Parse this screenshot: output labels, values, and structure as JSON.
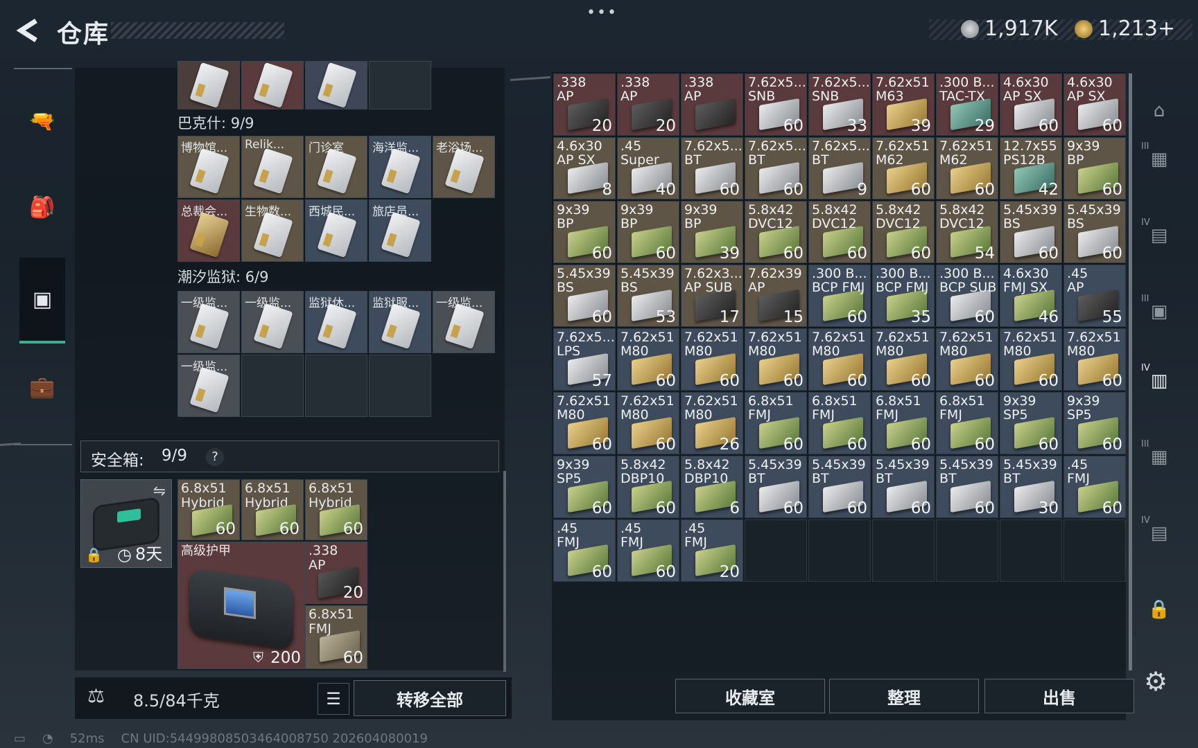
{
  "header": {
    "title": "仓库",
    "currencies": [
      {
        "icon": "silver-coin-icon",
        "value": "1,917K",
        "color": "#b8bcc0"
      },
      {
        "icon": "gold-coin-icon",
        "value": "1,213+",
        "color": "#c9a24a"
      }
    ]
  },
  "left_nav": [
    {
      "icon": "pistol-icon"
    },
    {
      "icon": "backpack-icon"
    },
    {
      "icon": "storage-case-icon",
      "active": true
    },
    {
      "icon": "briefcase-icon"
    }
  ],
  "left": {
    "group1_title": "巴克什: 9/9",
    "group1": [
      {
        "n": "博物馆...",
        "c": "tan"
      },
      {
        "n": "Relik...",
        "c": "tan"
      },
      {
        "n": "门诊室",
        "c": "tan"
      },
      {
        "n": "海洋监...",
        "c": "blue"
      },
      {
        "n": "老浴场...",
        "c": "tan"
      },
      {
        "n": "总裁会...",
        "c": "red",
        "gold": true
      },
      {
        "n": "生物数...",
        "c": "tan"
      },
      {
        "n": "西城民...",
        "c": "blue"
      },
      {
        "n": "旅店员...",
        "c": "blue"
      }
    ],
    "group2_title": "潮汐监狱: 6/9",
    "group2": [
      {
        "n": "一级监...",
        "c": "grey"
      },
      {
        "n": "一级监...",
        "c": "grey"
      },
      {
        "n": "监狱休...",
        "c": "blue"
      },
      {
        "n": "监狱服...",
        "c": "blue"
      },
      {
        "n": "一级监...",
        "c": "grey"
      },
      {
        "n": "一级监...",
        "c": "grey"
      }
    ],
    "safebox_label": "安全箱:",
    "safebox_count": "9/9",
    "safebox_help": "?",
    "safebox_timer": "8天",
    "safebox_items": [
      {
        "n": "6.8x51\nHybrid",
        "q": "60"
      },
      {
        "n": "6.8x51\nHybrid",
        "q": "60"
      },
      {
        "n": "6.8x51\nHybrid",
        "q": "60"
      }
    ],
    "armor_label": "高级护甲",
    "armor_value": "200",
    "ap338": {
      "n": ".338\nAP",
      "q": "20"
    },
    "fmj68": {
      "n": "6.8x51\nFMJ",
      "q": "60"
    },
    "weight": "8.5/84千克",
    "transfer_all": "转移全部"
  },
  "grid": [
    {
      "n": ".338\nAP",
      "q": "20",
      "c": "red"
    },
    {
      "n": ".338\nAP",
      "q": "20",
      "c": "red"
    },
    {
      "n": ".338\nAP",
      "q": "",
      "c": "red"
    },
    {
      "n": "7.62x5...\nSNB",
      "q": "60",
      "c": "red"
    },
    {
      "n": "7.62x5...\nSNB",
      "q": "33",
      "c": "red"
    },
    {
      "n": "7.62x51\nM63",
      "q": "39",
      "c": "red"
    },
    {
      "n": ".300 B...\nTAC-TX",
      "q": "29",
      "c": "red"
    },
    {
      "n": "4.6x30\nAP SX",
      "q": "60",
      "c": "red"
    },
    {
      "n": "4.6x30\nAP SX",
      "q": "60",
      "c": "red"
    },
    {
      "n": "4.6x30\nAP SX",
      "q": "8",
      "c": "tan"
    },
    {
      "n": ".45\nSuper",
      "q": "40",
      "c": "tan"
    },
    {
      "n": "7.62x5...\nBT",
      "q": "60",
      "c": "tan"
    },
    {
      "n": "7.62x5...\nBT",
      "q": "60",
      "c": "tan"
    },
    {
      "n": "7.62x5...\nBT",
      "q": "9",
      "c": "tan"
    },
    {
      "n": "7.62x51\nM62",
      "q": "60",
      "c": "tan"
    },
    {
      "n": "7.62x51\nM62",
      "q": "60",
      "c": "tan"
    },
    {
      "n": "12.7x55\nPS12B",
      "q": "42",
      "c": "tan"
    },
    {
      "n": "9x39\nBP",
      "q": "60",
      "c": "tan"
    },
    {
      "n": "9x39\nBP",
      "q": "60",
      "c": "tan"
    },
    {
      "n": "9x39\nBP",
      "q": "60",
      "c": "tan"
    },
    {
      "n": "9x39\nBP",
      "q": "39",
      "c": "tan"
    },
    {
      "n": "5.8x42\nDVC12",
      "q": "60",
      "c": "tan"
    },
    {
      "n": "5.8x42\nDVC12",
      "q": "60",
      "c": "tan"
    },
    {
      "n": "5.8x42\nDVC12",
      "q": "60",
      "c": "tan"
    },
    {
      "n": "5.8x42\nDVC12",
      "q": "54",
      "c": "tan"
    },
    {
      "n": "5.45x39\nBS",
      "q": "60",
      "c": "tan"
    },
    {
      "n": "5.45x39\nBS",
      "q": "60",
      "c": "tan"
    },
    {
      "n": "5.45x39\nBS",
      "q": "60",
      "c": "tan"
    },
    {
      "n": "5.45x39\nBS",
      "q": "53",
      "c": "tan"
    },
    {
      "n": "7.62x3...\nAP SUB",
      "q": "17",
      "c": "tan"
    },
    {
      "n": "7.62x39\nAP",
      "q": "15",
      "c": "tan"
    },
    {
      "n": ".300 B...\nBCP FMJ",
      "q": "60",
      "c": "blue"
    },
    {
      "n": ".300 B...\nBCP FMJ",
      "q": "35",
      "c": "blue"
    },
    {
      "n": ".300 B...\nBCP SUB",
      "q": "60",
      "c": "blue"
    },
    {
      "n": "4.6x30\nFMJ SX",
      "q": "46",
      "c": "blue"
    },
    {
      "n": ".45\nAP",
      "q": "55",
      "c": "blue"
    },
    {
      "n": "7.62x5...\nLPS",
      "q": "57",
      "c": "blue"
    },
    {
      "n": "7.62x51\nM80",
      "q": "60",
      "c": "blue"
    },
    {
      "n": "7.62x51\nM80",
      "q": "60",
      "c": "blue"
    },
    {
      "n": "7.62x51\nM80",
      "q": "60",
      "c": "blue"
    },
    {
      "n": "7.62x51\nM80",
      "q": "60",
      "c": "blue"
    },
    {
      "n": "7.62x51\nM80",
      "q": "60",
      "c": "blue"
    },
    {
      "n": "7.62x51\nM80",
      "q": "60",
      "c": "blue"
    },
    {
      "n": "7.62x51\nM80",
      "q": "60",
      "c": "blue"
    },
    {
      "n": "7.62x51\nM80",
      "q": "60",
      "c": "blue"
    },
    {
      "n": "7.62x51\nM80",
      "q": "60",
      "c": "blue"
    },
    {
      "n": "7.62x51\nM80",
      "q": "60",
      "c": "blue"
    },
    {
      "n": "7.62x51\nM80",
      "q": "26",
      "c": "blue"
    },
    {
      "n": "6.8x51\nFMJ",
      "q": "60",
      "c": "blue"
    },
    {
      "n": "6.8x51\nFMJ",
      "q": "60",
      "c": "blue"
    },
    {
      "n": "6.8x51\nFMJ",
      "q": "60",
      "c": "blue"
    },
    {
      "n": "6.8x51\nFMJ",
      "q": "60",
      "c": "blue"
    },
    {
      "n": "9x39\nSP5",
      "q": "60",
      "c": "blue"
    },
    {
      "n": "9x39\nSP5",
      "q": "60",
      "c": "blue"
    },
    {
      "n": "9x39\nSP5",
      "q": "60",
      "c": "blue"
    },
    {
      "n": "5.8x42\nDBP10",
      "q": "60",
      "c": "blue"
    },
    {
      "n": "5.8x42\nDBP10",
      "q": "6",
      "c": "blue"
    },
    {
      "n": "5.45x39\nBT",
      "q": "60",
      "c": "blue"
    },
    {
      "n": "5.45x39\nBT",
      "q": "60",
      "c": "blue"
    },
    {
      "n": "5.45x39\nBT",
      "q": "60",
      "c": "blue"
    },
    {
      "n": "5.45x39\nBT",
      "q": "60",
      "c": "blue"
    },
    {
      "n": "5.45x39\nBT",
      "q": "30",
      "c": "blue"
    },
    {
      "n": ".45\nFMJ",
      "q": "60",
      "c": "blue"
    },
    {
      "n": ".45\nFMJ",
      "q": "60",
      "c": "blue"
    },
    {
      "n": ".45\nFMJ",
      "q": "60",
      "c": "blue"
    },
    {
      "n": ".45\nFMJ",
      "q": "20",
      "c": "blue"
    }
  ],
  "right_buttons": [
    "收藏室",
    "整理",
    "出售"
  ],
  "right_nav": [
    {
      "icon": "shelter-icon"
    },
    {
      "icon": "tier3-weapon-case-icon",
      "tier": "III"
    },
    {
      "icon": "tier4-tool-case-icon",
      "tier": "IV"
    },
    {
      "icon": "tier3-case-icon",
      "tier": "III"
    },
    {
      "icon": "tier4-ammo-case-icon",
      "tier": "IV",
      "active": true
    },
    {
      "icon": "tier3-rack-icon",
      "tier": "III"
    },
    {
      "icon": "tier4-rack-icon",
      "tier": "IV"
    },
    {
      "icon": "lock-icon"
    }
  ],
  "status": {
    "ping": "52ms",
    "uid": "CN UID:5449980850346400875​0 202604080019"
  }
}
